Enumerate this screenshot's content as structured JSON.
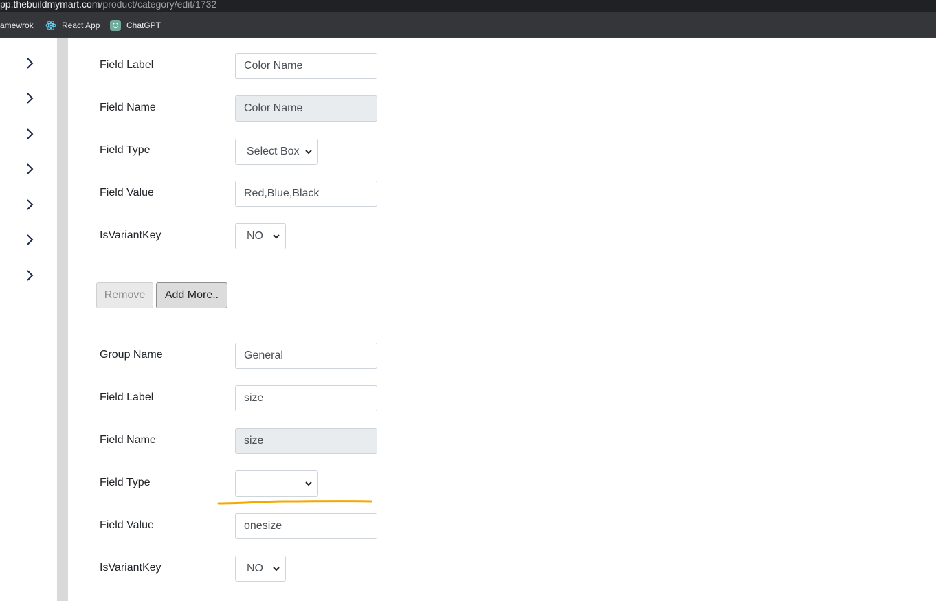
{
  "browser": {
    "url_host": "pp.thebuildmymart.com",
    "url_path": "/product/category/edit/1732",
    "bookmarks": [
      {
        "label": "amewrok",
        "icon": "none"
      },
      {
        "label": "React App",
        "icon": "react-icon"
      },
      {
        "label": "ChatGPT",
        "icon": "chatgpt-icon"
      }
    ]
  },
  "sidebar": {
    "items": [
      {
        "icon": "chevron-right-icon"
      },
      {
        "icon": "chevron-right-icon"
      },
      {
        "icon": "chevron-right-icon"
      },
      {
        "icon": "chevron-right-icon"
      },
      {
        "icon": "chevron-right-icon"
      },
      {
        "icon": "chevron-right-icon"
      },
      {
        "icon": "chevron-right-icon"
      }
    ]
  },
  "group1": {
    "field_label": {
      "label": "Field Label",
      "value": "Color Name"
    },
    "field_name": {
      "label": "Field Name",
      "value": "Color Name"
    },
    "field_type": {
      "label": "Field Type",
      "value": "Select Box"
    },
    "field_value": {
      "label": "Field Value",
      "value": "Red,Blue,Black"
    },
    "is_variant_key": {
      "label": "IsVariantKey",
      "value": "NO"
    }
  },
  "buttons": {
    "remove": "Remove",
    "add_more": "Add More.."
  },
  "group2": {
    "group_name": {
      "label": "Group Name",
      "value": "General"
    },
    "field_label": {
      "label": "Field Label",
      "value": "size"
    },
    "field_name": {
      "label": "Field Name",
      "value": "size"
    },
    "field_type": {
      "label": "Field Type",
      "value": ""
    },
    "field_value": {
      "label": "Field Value",
      "value": "onesize"
    },
    "is_variant_key": {
      "label": "IsVariantKey",
      "value": "NO"
    }
  },
  "colors": {
    "annotation": "#f5a800",
    "chrome_dark": "#202124",
    "bookmarks_bar": "#35363a",
    "readonly_bg": "#e9ecef",
    "border": "#ced4da"
  }
}
